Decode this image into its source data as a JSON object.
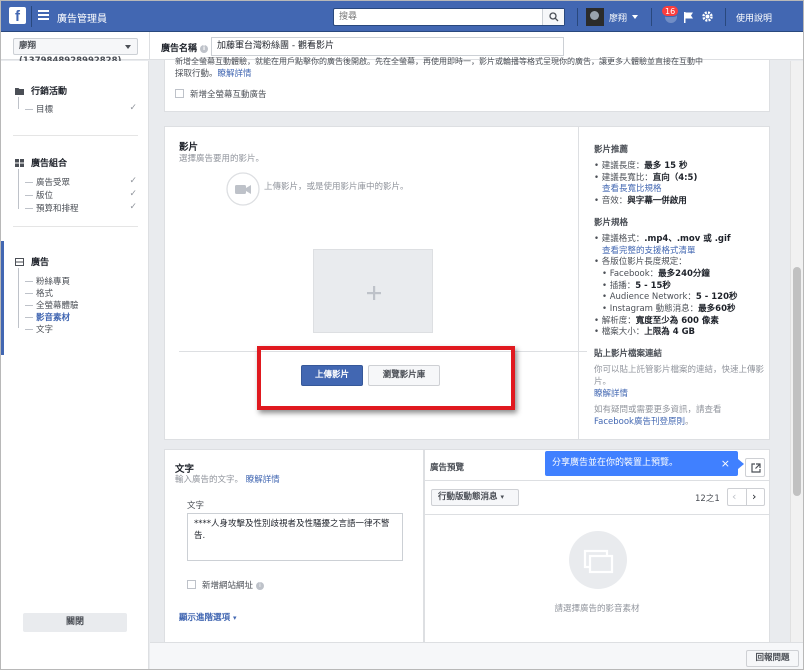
{
  "topbar": {
    "app_title": "廣告管理員",
    "search_placeholder": "搜尋",
    "user_name": "廖翔",
    "notif_count": "16",
    "help_label": "使用說明"
  },
  "subbar": {
    "account": "廖翔 (1379848928992828)",
    "ad_name_label": "廣告名稱",
    "ad_name_value": "加藤軍台灣粉絲團 - 觀看影片"
  },
  "sidebar": {
    "campaign": {
      "title": "行銷活動",
      "items": [
        {
          "label": "目標"
        }
      ]
    },
    "adset": {
      "title": "廣告組合",
      "items": [
        {
          "label": "廣告受眾"
        },
        {
          "label": "版位"
        },
        {
          "label": "預算和排程"
        }
      ]
    },
    "ad": {
      "title": "廣告",
      "items": [
        {
          "label": "粉絲專頁"
        },
        {
          "label": "格式"
        },
        {
          "label": "全螢幕體驗"
        },
        {
          "label": "影音素材"
        },
        {
          "label": "文字"
        }
      ]
    },
    "close_label": "關閉"
  },
  "top_card": {
    "partial_text": "新增全螢幕互動體驗，就能在用戶點擊你的廣告後開啟。先在全螢幕，再使用即時一，影片或輪播等格式呈現你的廣告，讓更多人體驗並直接在互動中",
    "partial_text_2": "採取行動。",
    "learn_more": "瞭解詳情",
    "checkbox_label": "新增全螢幕互動廣告"
  },
  "video_section": {
    "title": "影片",
    "subtitle": "選擇廣告要用的影片。",
    "upload_hint": "上傳影片，或是使用影片庫中的影片。",
    "upload_btn": "上傳影片",
    "browse_btn": "瀏覽影片庫"
  },
  "video_tips": {
    "rec_title": "影片推薦",
    "rec_items": [
      {
        "label": "建議長度：",
        "value": "最多 15 秒"
      },
      {
        "label": "建議長寬比：",
        "value": "直向（4:5)"
      }
    ],
    "rec_link": "查看長寬比規格",
    "sound_label": "音效：",
    "sound_value": "與字幕一併啟用",
    "spec_title": "影片規格",
    "format_label": "建議格式：",
    "format_value": ".mp4、.mov 或 .gif",
    "format_link": "查看完整的支援格式清單",
    "length_label": "各版位影片長度規定：",
    "length_items": [
      {
        "label": "Facebook：",
        "value": "最多240分鐘"
      },
      {
        "label": "插播：",
        "value": "5 - 15秒"
      },
      {
        "label": "Audience Network：",
        "value": "5 - 120秒"
      },
      {
        "label": "Instagram 動態消息：",
        "value": "最多60秒"
      }
    ],
    "resolution_label": "解析度：",
    "resolution_value": "寬度至少為 600 像素",
    "filesize_label": "檔案大小：",
    "filesize_value": "上限為 4 GB",
    "paste_title": "貼上影片檔案連結",
    "paste_text": "你可以貼上託管影片檔案的連結，快速上傳影片。",
    "paste_link": "瞭解詳情",
    "more_text": "如有疑問或需要更多資訊，請查看",
    "more_link": "Facebook廣告刊登原則",
    "more_end": "。"
  },
  "text_section": {
    "title": "文字",
    "subtitle": "輸入廣告的文字。",
    "learn_more": "瞭解詳情",
    "field_label": "文字",
    "field_value": "****人身攻擊及性別歧視者及性騷擾之言語一律不警告.",
    "checkbox_label": "新增網站網址",
    "advanced": "顯示進階選項"
  },
  "preview": {
    "title": "廣告預覽",
    "tooltip": "分享廣告並在你的裝置上預覽。",
    "placement": "行動版動態消息",
    "pager": "12之1",
    "empty_text": "請選擇廣告的影音素材"
  },
  "footer": {
    "report": "回報問題"
  },
  "colors": {
    "brand": "#4267b2",
    "highlight_box": "#e0191f",
    "tooltip": "#4080ff"
  }
}
